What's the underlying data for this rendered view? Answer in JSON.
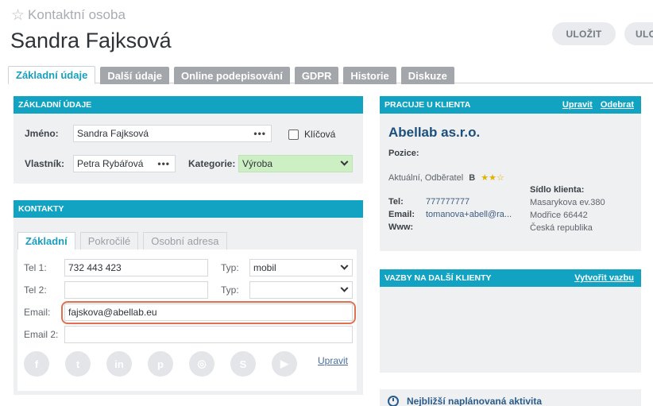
{
  "header": {
    "breadcrumb": "Kontaktní osoba",
    "title": "Sandra Fajksová",
    "save_label": "ULOŽIT",
    "save2_label": "ULO"
  },
  "tabs": [
    "Základní údaje",
    "Další údaje",
    "Online podepisování",
    "GDPR",
    "Historie",
    "Diskuze"
  ],
  "basic": {
    "heading": "ZÁKLADNÍ ÚDAJE",
    "name_label": "Jméno:",
    "name_value": "Sandra Fajksová",
    "key_label": "Klíčová",
    "owner_label": "Vlastník:",
    "owner_value": "Petra Rybářová",
    "category_label": "Kategorie:",
    "category_value": "Výroba"
  },
  "contacts": {
    "heading": "KONTAKTY",
    "subtabs": [
      "Základní",
      "Pokročilé",
      "Osobní adresa"
    ],
    "tel1_label": "Tel 1:",
    "tel1_value": "732 443 423",
    "type_label": "Typ:",
    "type1_value": "mobil",
    "tel2_label": "Tel 2:",
    "tel2_value": "",
    "type2_label": "Typ:",
    "type2_value": "",
    "email_label": "Email:",
    "email_value": "fajskova@abellab.eu",
    "email2_label": "Email 2:",
    "email2_value": "",
    "edit_link": "Upravit",
    "social_icons": [
      "facebook-icon",
      "twitter-icon",
      "linkedin-icon",
      "pinterest-icon",
      "instagram-icon",
      "skype-icon",
      "youtube-icon"
    ]
  },
  "client": {
    "heading": "PRACUJE U KLIENTA",
    "edit_link": "Upravit",
    "remove_link": "Odebrat",
    "name": "Abellab as.r.o.",
    "position_label": "Pozice:",
    "status": "Aktuální, Odběratel",
    "rating_letter": "B",
    "stars": "★★☆",
    "tel_label": "Tel:",
    "tel_value": "777777777",
    "email_label": "Email:",
    "email_value": "tomanova+abell@ra...",
    "www_label": "Www:",
    "seat_label": "Sídlo klienta:",
    "address1": "Masarykova ev.380",
    "address2": "Modřice 66442",
    "address3": "Česká republika"
  },
  "relations": {
    "heading": "VAZBY NA DALŠÍ KLIENTY",
    "create_link": "Vytvořit vazbu"
  },
  "activity": {
    "label": "Nejbližší naplánovaná aktivita"
  },
  "colors": {
    "accent": "#12a3c2",
    "email_highlight": "#e07050",
    "category_bg": "#ccefc4"
  }
}
